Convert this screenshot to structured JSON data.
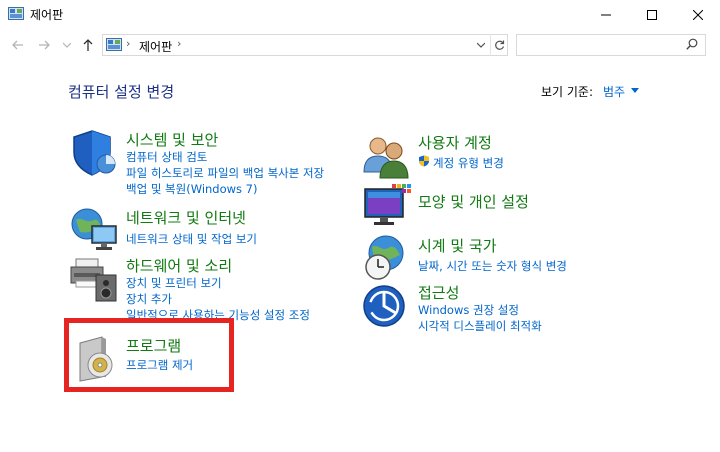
{
  "window": {
    "title": "제어판"
  },
  "nav": {
    "breadcrumb": [
      "제어판"
    ],
    "search_placeholder": ""
  },
  "content": {
    "heading": "컴퓨터 설정 변경",
    "view_by_label": "보기 기준:",
    "view_by_value": "범주"
  },
  "categories_left": [
    {
      "title": "시스템 및 보안",
      "links": [
        "컴퓨터 상태 검토",
        "파일 히스토리로 파일의 백업 복사본 저장",
        "백업 및 복원(Windows 7)"
      ]
    },
    {
      "title": "네트워크 및 인터넷",
      "links": [
        "네트워크 상태 및 작업 보기"
      ]
    },
    {
      "title": "하드웨어 및 소리",
      "links": [
        "장치 및 프린터 보기",
        "장치 추가",
        "일반적으로 사용하는 기능성 설정 조정"
      ]
    },
    {
      "title": "프로그램",
      "links": [
        "프로그램 제거"
      ]
    }
  ],
  "categories_right": [
    {
      "title": "사용자 계정",
      "links": [
        "계정 유형 변경"
      ]
    },
    {
      "title": "모양 및 개인 설정",
      "links": []
    },
    {
      "title": "시계 및 국가",
      "links": [
        "날짜, 시간 또는 숫자 형식 변경"
      ]
    },
    {
      "title": "접근성",
      "links": [
        "Windows 권장 설정",
        "시각적 디스플레이 최적화"
      ]
    }
  ],
  "colors": {
    "heading": "#1e3287",
    "category_title": "#127a12",
    "link": "#0066cc",
    "highlight": "#e52521"
  }
}
